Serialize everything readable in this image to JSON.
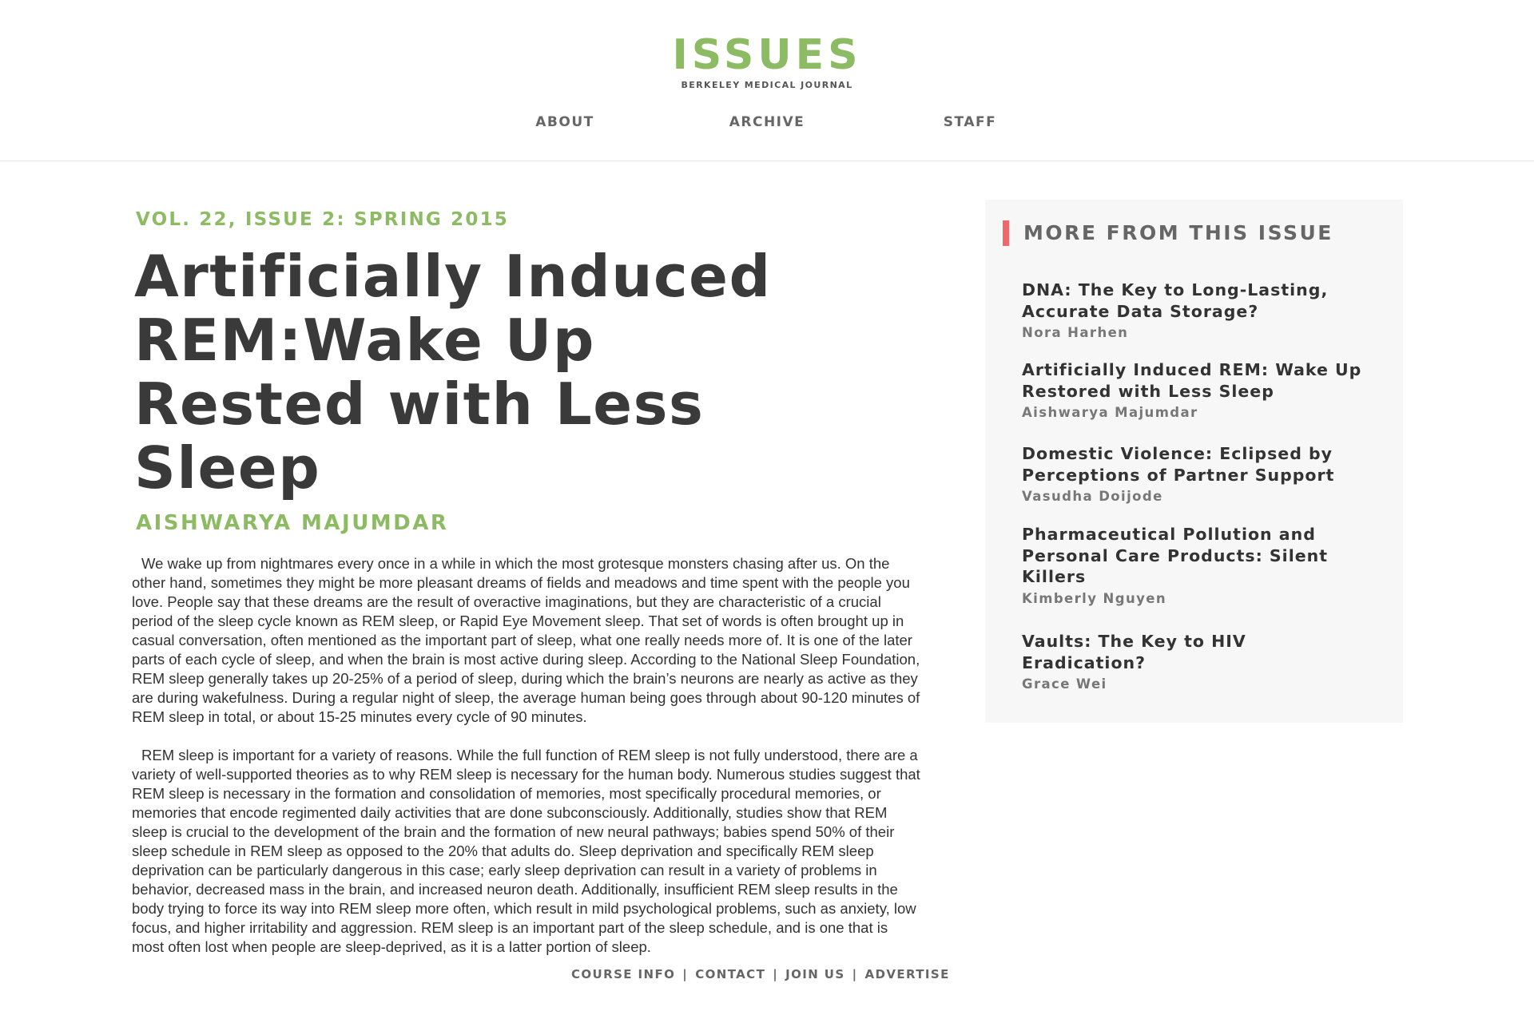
{
  "header": {
    "logo_title": "ISSUES",
    "logo_subtitle": "BERKELEY MEDICAL JOURNAL",
    "nav": [
      "ABOUT",
      "ARCHIVE",
      "STAFF"
    ]
  },
  "article": {
    "issue_label": "VOL. 22, ISSUE 2: SPRING 2015",
    "title": "Artificially Induced REM:Wake Up Rested with Less Sleep",
    "author": "AISHWARYA MAJUMDAR",
    "paragraphs": [
      "We wake up from nightmares every once in a while in which the most grotesque monsters chasing after us. On the other hand, sometimes they might be more pleasant dreams of fields and meadows and time spent with the people you love. People say that these dreams are the result of overactive imaginations, but they are characteristic of a crucial period of the sleep cycle known as REM sleep, or Rapid Eye Movement sleep. That set of words is often brought up in casual conversation, often mentioned as the important part of sleep, what one really needs more of. It is one of the later parts of each cycle of sleep, and when the brain is most active during sleep. According to the National Sleep Foundation, REM sleep generally takes up 20-25% of a period of sleep, during which the brain’s neurons are nearly as active as they are during wakefulness. During a regular night of sleep, the average human being goes through about 90-120 minutes of REM sleep in total, or about 15-25 minutes every cycle of 90 minutes.",
      "REM sleep is important for a variety of reasons. While the full function of REM sleep is not fully understood, there are a variety of well-supported theories as to why REM sleep is necessary for the human body. Numerous studies suggest that REM sleep is necessary in the formation and consolidation of memories, most specifically procedural memories, or memories that encode regimented daily activities that are done subconsciously. Additionally, studies show that REM sleep is crucial to the development of the brain and the formation of new neural pathways; babies spend 50% of their sleep schedule in REM sleep as opposed to the 20% that adults do. Sleep deprivation and specifically REM sleep deprivation can be particularly dangerous in this case; early sleep deprivation can result in a variety of problems in behavior, decreased mass in the brain, and increased neuron death. Additionally, insufficient REM sleep results in the body trying to force its way into REM sleep more often, which result in mild psychological problems, such as anxiety, low focus, and higher irritability and aggression. REM sleep is an important part of the sleep schedule, and is one that is most often lost when people are sleep-deprived, as it is a latter portion of sleep."
    ]
  },
  "sidebar": {
    "heading": "MORE FROM THIS ISSUE",
    "accent_color": "#f0686a",
    "items": [
      {
        "title": "DNA: The Key to Long-Lasting, Accurate Data Storage?",
        "author": "Nora Harhen"
      },
      {
        "title": "Artificially Induced REM: Wake Up Restored with Less Sleep",
        "author": "Aishwarya Majumdar"
      },
      {
        "title": "Domestic Violence: Eclipsed by Perceptions of Partner Support",
        "author": "Vasudha Doijode"
      },
      {
        "title": "Pharmaceutical Pollution and Personal Care Products: Silent Killers",
        "author": "Kimberly Nguyen"
      },
      {
        "title": "Vaults: The Key to HIV Eradication?",
        "author": "Grace Wei"
      }
    ]
  },
  "footer": {
    "links": [
      "COURSE INFO",
      "CONTACT",
      "JOIN US",
      "ADVERTISE"
    ],
    "separator": "|"
  },
  "colors": {
    "brand_green": "#8cbb63",
    "text_dark": "#3a3a3a",
    "sidebar_bg": "#f7f7f7"
  }
}
